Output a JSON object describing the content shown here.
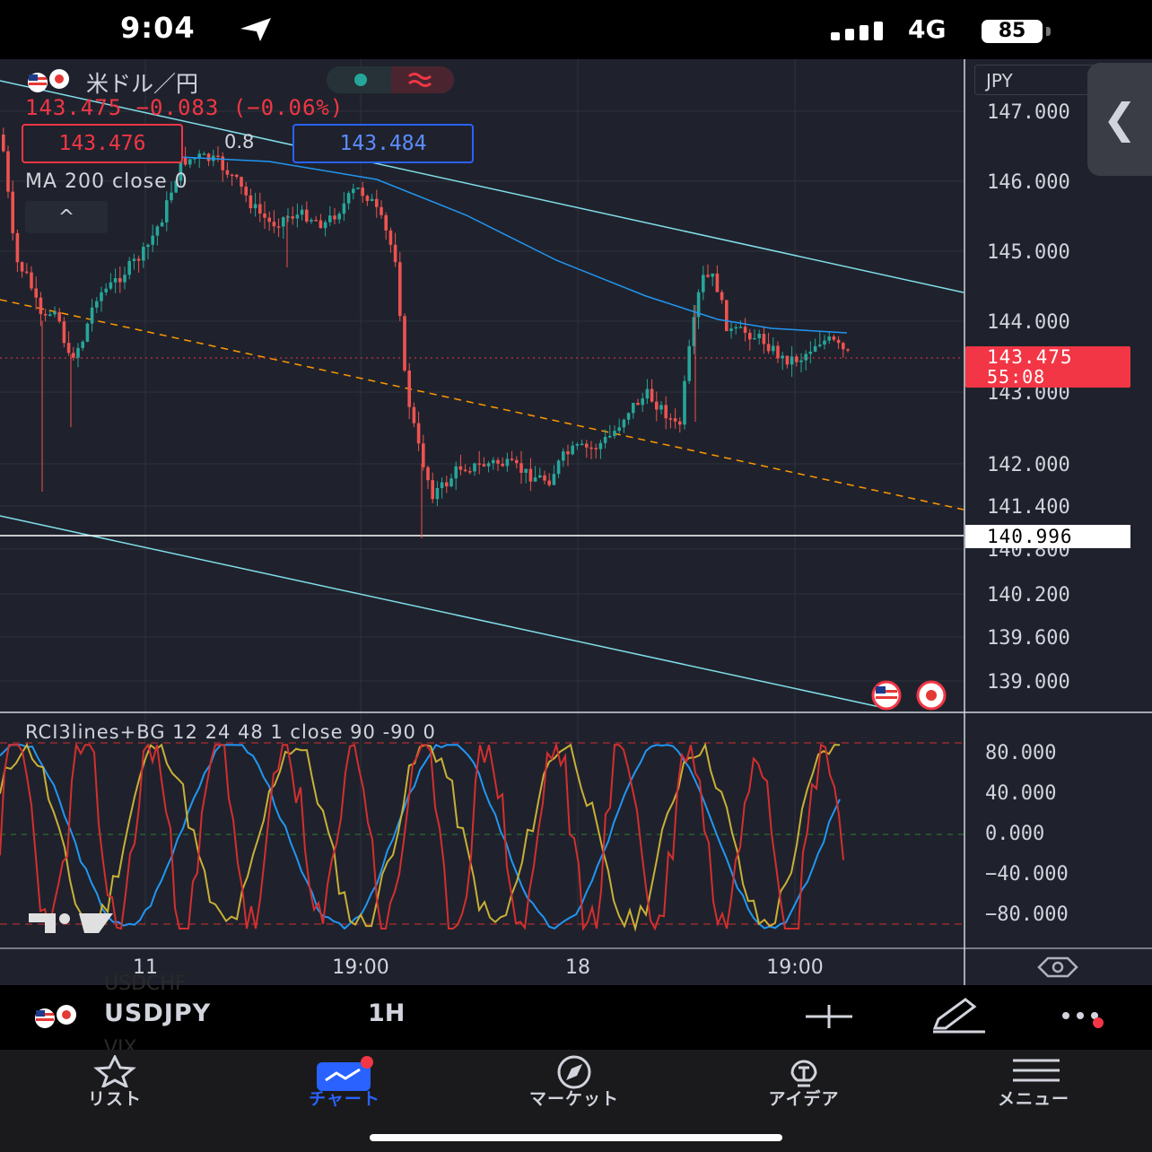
{
  "status_bar": {
    "time": "9:04",
    "network": "4G",
    "battery": "85"
  },
  "chart": {
    "symbol_name": "米ドル／円",
    "price_change": "143.475 −0.083 (−0.06%)",
    "bid": "143.476",
    "spread": "0.8",
    "ask": "143.484",
    "ma_label": "MA 200 close 0",
    "collapse_symbol": "^",
    "currency": "JPY",
    "side_tab_symbol": "❮",
    "last_price": "143.475",
    "countdown": "55:08",
    "level_price": "140.996",
    "price_axis": [
      "147.000",
      "146.000",
      "145.000",
      "144.000",
      "143.000",
      "142.000",
      "141.400",
      "140.800",
      "140.200",
      "139.600",
      "139.000"
    ],
    "time_axis": [
      "11",
      "19:00",
      "18",
      "19:00"
    ],
    "indicator_label": "RCI3lines+BG 12 24 48 1 close 90 -90 0",
    "indicator_axis": [
      "80.000",
      "40.000",
      "0.000",
      "−40.000",
      "−80.000"
    ],
    "colors": {
      "up": "#26a69a",
      "down": "#ef5350",
      "ma": "#2196f3",
      "trend_line": "#80deea",
      "dashed_line": "#ff9800",
      "rci_short": "#d32f2f",
      "rci_mid": "#c9b037",
      "rci_long": "#2196f3"
    }
  },
  "toolbar": {
    "symbol": "USDJPY",
    "interval": "1H",
    "ghost_above": "USDCHF",
    "ghost_below": "VIX"
  },
  "tabs": [
    {
      "label": "リスト",
      "icon": "star-icon",
      "active": false
    },
    {
      "label": "チャート",
      "icon": "chart-icon",
      "active": true
    },
    {
      "label": "マーケット",
      "icon": "compass-icon",
      "active": false
    },
    {
      "label": "アイデア",
      "icon": "lightbulb-icon",
      "active": false
    },
    {
      "label": "メニュー",
      "icon": "menu-icon",
      "active": false
    }
  ]
}
